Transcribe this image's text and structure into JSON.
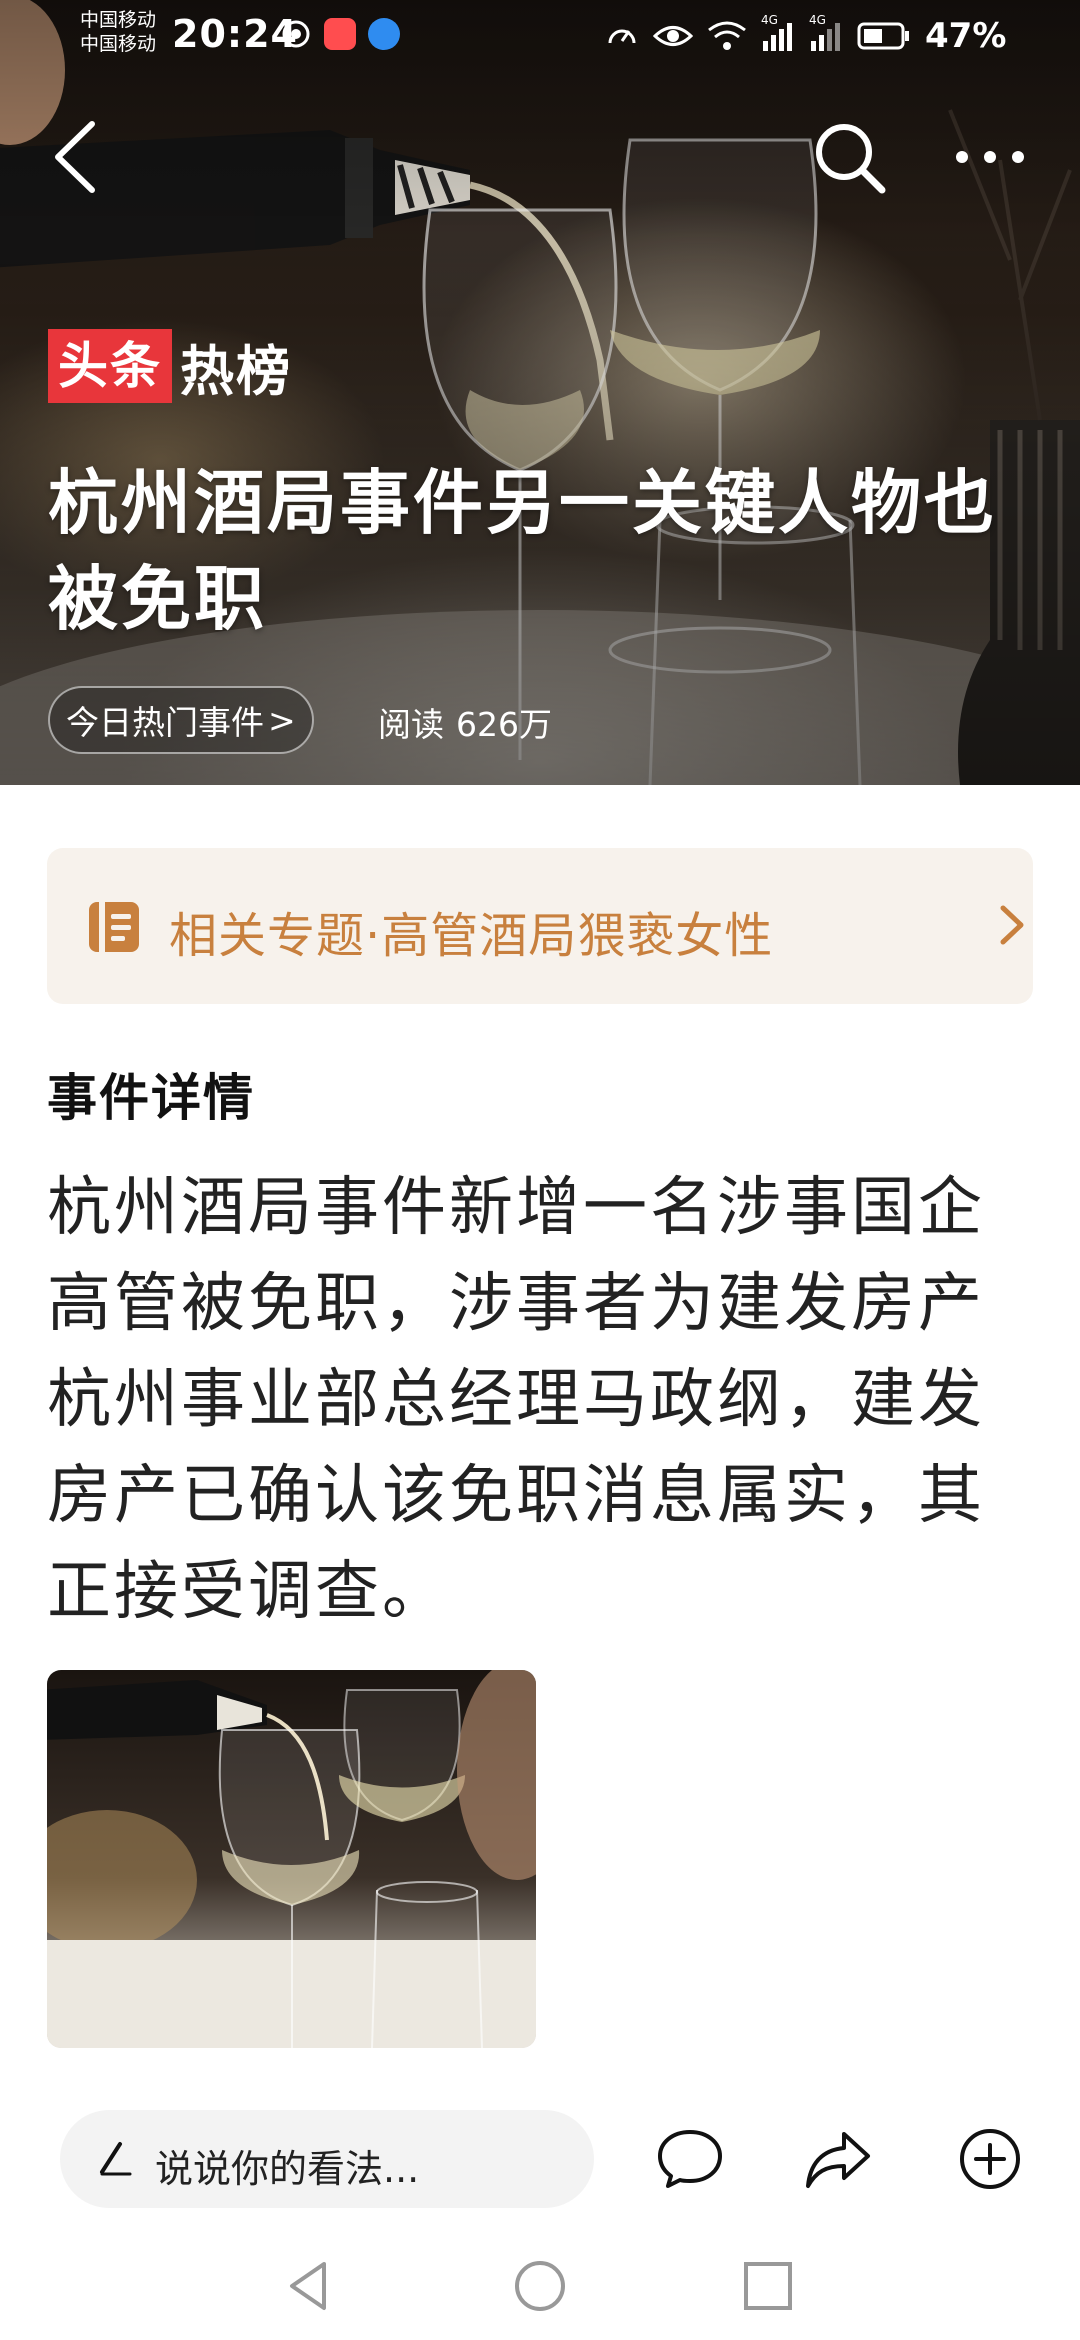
{
  "status_bar": {
    "carrier_1": "中国移动",
    "carrier_2": "中国移动",
    "time": "20:24",
    "network_1": "4G",
    "network_2": "4G",
    "battery": "47%"
  },
  "header": {
    "brand_red": "头条",
    "brand_text": "热榜",
    "title": "杭州酒局事件另一关键人物也被免职",
    "chip_label": "今日热门事件",
    "chip_chevron": ">",
    "reads_label": "阅读",
    "reads_count": "626万"
  },
  "topic": {
    "label": "相关专题·高管酒局猥亵女性",
    "icon": "document-icon"
  },
  "content": {
    "section_title": "事件详情",
    "body": "杭州酒局事件新增一名涉事国企高管被免职，涉事者为建发房产杭州事业部总经理马政纲，建发房产已确认该免职消息属实，其正接受调查。"
  },
  "bottom_bar": {
    "comment_placeholder": "说说你的看法..."
  },
  "colors": {
    "brand_red": "#e8363b",
    "topic_text": "#c8803e",
    "topic_bg": "#f7f2ec",
    "input_bg": "#f3f3f3"
  }
}
